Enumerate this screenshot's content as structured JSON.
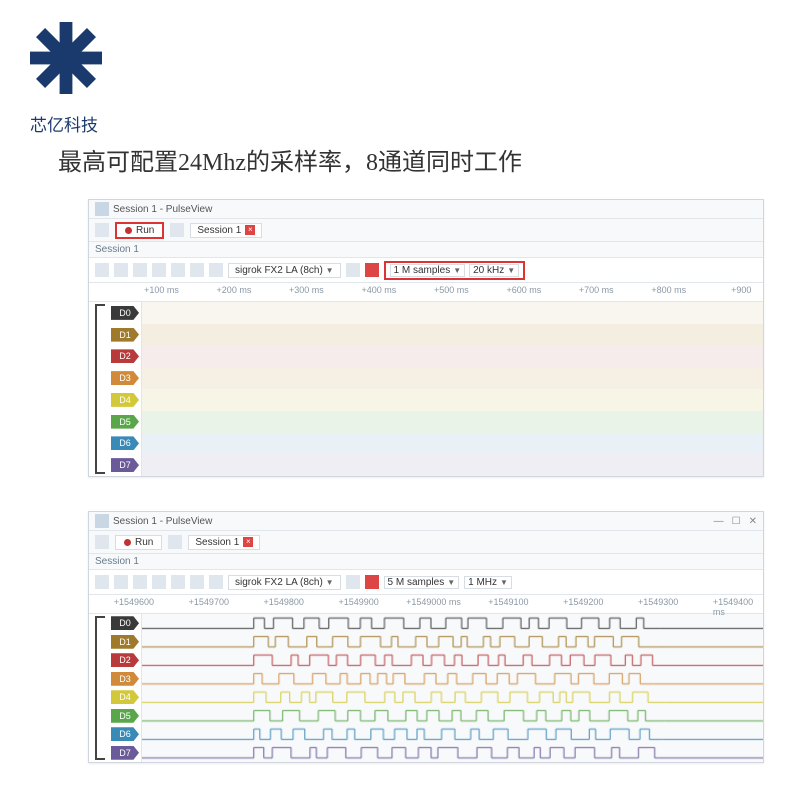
{
  "brand": "芯亿科技",
  "headline": "最高可配置24Mhz的采样率，8通道同时工作",
  "window1": {
    "title": "Session 1 - PulseView",
    "run_label": "Run",
    "session_tab": "Session 1",
    "session_header": "Session 1",
    "device": "sigrok FX2 LA (8ch)",
    "samples": "1 M samples",
    "rate": "20 kHz",
    "ruler": [
      "+100 ms",
      "+200 ms",
      "+300 ms",
      "+400 ms",
      "+500 ms",
      "+600 ms",
      "+700 ms",
      "+800 ms",
      "+900"
    ],
    "channels": [
      {
        "name": "D0",
        "color": "#3a3a3a",
        "bg": "#f9f6f0"
      },
      {
        "name": "D1",
        "color": "#9e7a2a",
        "bg": "#f4eee1"
      },
      {
        "name": "D2",
        "color": "#b83a3a",
        "bg": "#f7ecec"
      },
      {
        "name": "D3",
        "color": "#d08a3a",
        "bg": "#f5efe4"
      },
      {
        "name": "D4",
        "color": "#d2c83a",
        "bg": "#f6f5e6"
      },
      {
        "name": "D5",
        "color": "#5aa64a",
        "bg": "#eaf3e8"
      },
      {
        "name": "D6",
        "color": "#3a8ab8",
        "bg": "#e9f1f6"
      },
      {
        "name": "D7",
        "color": "#6a5a9a",
        "bg": "#efeef5"
      }
    ]
  },
  "window2": {
    "title": "Session 1 - PulseView",
    "run_label": "Run",
    "session_tab": "Session 1",
    "session_header": "Session 1",
    "device": "sigrok FX2 LA (8ch)",
    "samples": "5 M samples",
    "rate": "1 MHz",
    "ruler": [
      "+1549600",
      "+1549700",
      "+1549800",
      "+1549900",
      "+1549000 ms",
      "+1549100",
      "+1549200",
      "+1549300",
      "+1549400 ms"
    ],
    "channels": [
      {
        "name": "D0",
        "color": "#3a3a3a"
      },
      {
        "name": "D1",
        "color": "#9e7a2a"
      },
      {
        "name": "D2",
        "color": "#b83a3a"
      },
      {
        "name": "D3",
        "color": "#d08a3a"
      },
      {
        "name": "D4",
        "color": "#d2c83a"
      },
      {
        "name": "D5",
        "color": "#5aa64a"
      },
      {
        "name": "D6",
        "color": "#3a8ab8"
      },
      {
        "name": "D7",
        "color": "#6a5a9a"
      }
    ]
  }
}
